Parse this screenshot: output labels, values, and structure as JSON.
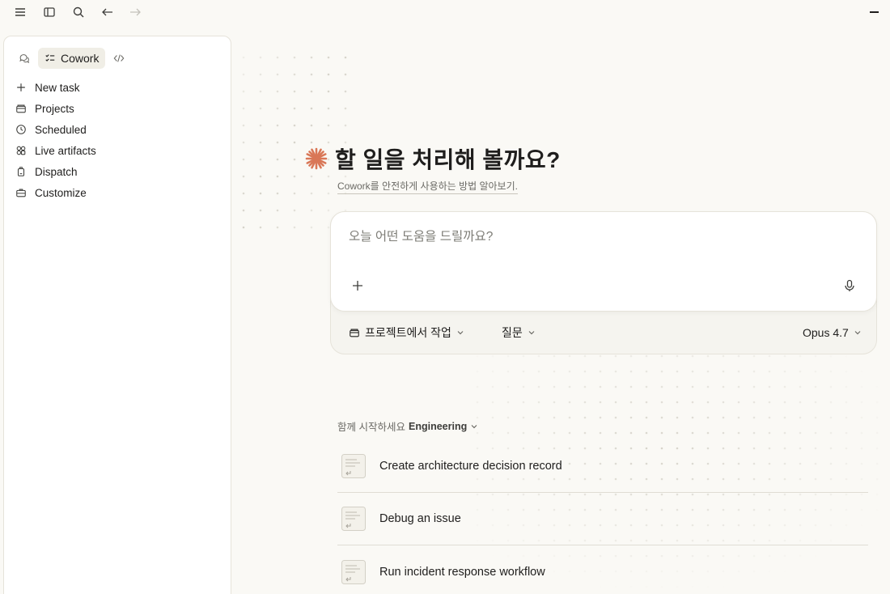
{
  "sidebar": {
    "active_mode": "Cowork",
    "items": [
      {
        "label": "New task",
        "icon": "plus-icon"
      },
      {
        "label": "Projects",
        "icon": "folder-icon"
      },
      {
        "label": "Scheduled",
        "icon": "clock-icon"
      },
      {
        "label": "Live artifacts",
        "icon": "artifacts-icon"
      },
      {
        "label": "Dispatch",
        "icon": "dispatch-icon"
      },
      {
        "label": "Customize",
        "icon": "briefcase-icon"
      }
    ]
  },
  "main": {
    "title": "할 일을 처리해 볼까요?",
    "safety_link": "Cowork를 안전하게 사용하는 방법 알아보기",
    "safety_link_suffix": ".",
    "composer": {
      "placeholder": "오늘 어떤 도움을 드릴까요?",
      "project_button": "프로젝트에서 작업",
      "mode_button": "질문",
      "model_button": "Opus 4.7"
    },
    "start": {
      "label": "함께 시작하세요",
      "category": "Engineering"
    },
    "tasks": [
      {
        "label": "Create architecture decision record"
      },
      {
        "label": "Debug an issue"
      },
      {
        "label": "Run incident response workflow"
      }
    ]
  },
  "colors": {
    "accent": "#d97757",
    "background": "#faf9f5",
    "sidebar": "#ffffff"
  }
}
